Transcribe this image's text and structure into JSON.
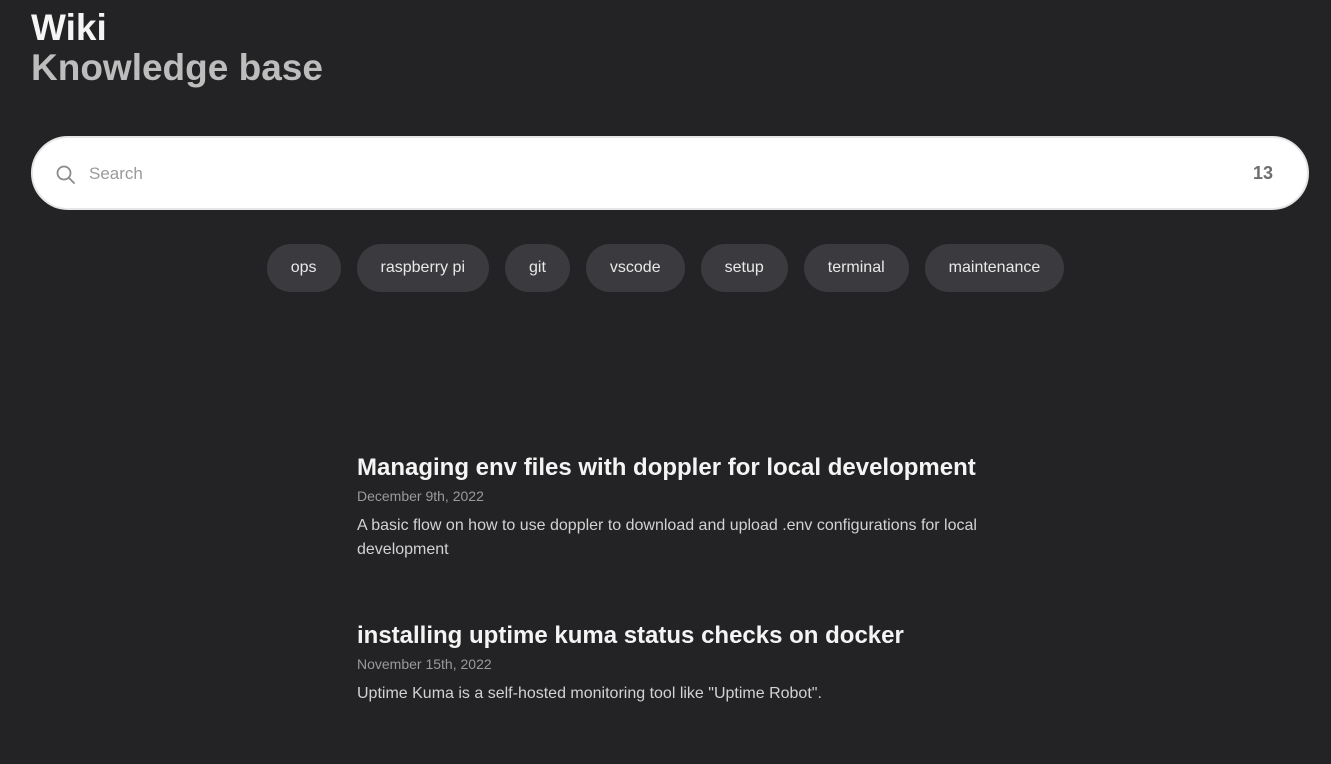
{
  "header": {
    "title": "Wiki",
    "subtitle": "Knowledge base"
  },
  "search": {
    "placeholder": "Search",
    "value": "",
    "count": "13",
    "icon": "search-icon"
  },
  "tags": [
    {
      "label": "ops"
    },
    {
      "label": "raspberry pi"
    },
    {
      "label": "git"
    },
    {
      "label": "vscode"
    },
    {
      "label": "setup"
    },
    {
      "label": "terminal"
    },
    {
      "label": "maintenance"
    }
  ],
  "posts": [
    {
      "title": "Managing env files with doppler for local development",
      "date": "December 9th, 2022",
      "description": "A basic flow on how to use doppler to download and upload .env configurations for local development"
    },
    {
      "title": "installing uptime kuma status checks on docker",
      "date": "November 15th, 2022",
      "description": "Uptime Kuma is a self-hosted monitoring tool like \"Uptime Robot\"."
    }
  ],
  "colors": {
    "background": "#232325",
    "tag_background": "#3b3b3f",
    "search_background": "#ffffff"
  }
}
